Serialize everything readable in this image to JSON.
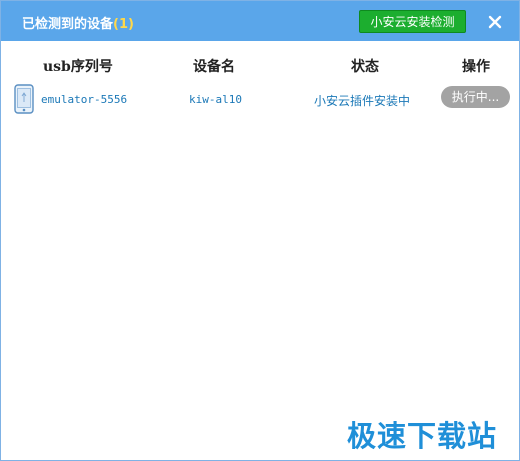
{
  "window": {
    "title": "已检测到的设备",
    "count": "(1)",
    "check_button": "小安云安装检测",
    "close_icon": "close-icon"
  },
  "table": {
    "columns": [
      "usb序列号",
      "设备名",
      "状态",
      "操作"
    ],
    "rows": [
      {
        "icon": "phone-icon",
        "serial": "emulator-5556",
        "device_name": "kiw-al10",
        "status": "小安云插件安装中",
        "action": "执行中..."
      }
    ]
  },
  "watermark": "极速下载站",
  "colors": {
    "titlebar": "#5aa6ea",
    "check_button": "#1cae2f",
    "count": "#ffd84a",
    "link_text": "#1b78b7",
    "action_button": "#a3a3a3",
    "watermark": "#1f8fd8"
  }
}
